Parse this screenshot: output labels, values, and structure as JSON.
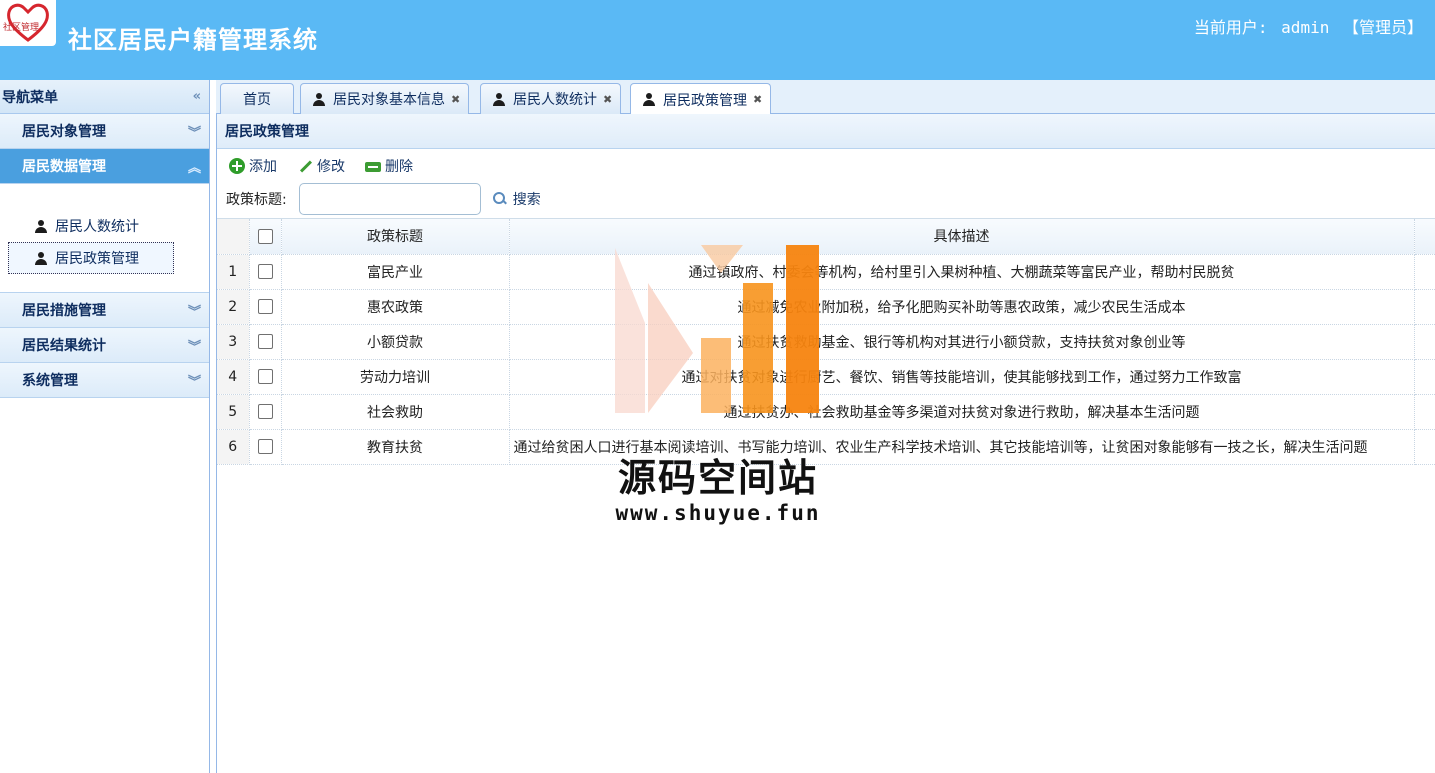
{
  "header": {
    "logo_text": "社区管理",
    "title": "社区居民户籍管理系统",
    "user_label": "当前用户:",
    "user_name": "admin",
    "user_role": "【管理员】"
  },
  "sidebar": {
    "title": "导航菜单",
    "groups": [
      {
        "label": "居民对象管理"
      },
      {
        "label": "居民数据管理"
      },
      {
        "label": "居民措施管理"
      },
      {
        "label": "居民结果统计"
      },
      {
        "label": "系统管理"
      }
    ],
    "sub_items": [
      {
        "label": "居民人数统计"
      },
      {
        "label": "居民政策管理"
      }
    ]
  },
  "tabs": [
    {
      "label": "首页"
    },
    {
      "label": "居民对象基本信息"
    },
    {
      "label": "居民人数统计"
    },
    {
      "label": "居民政策管理"
    }
  ],
  "panel": {
    "title": "居民政策管理",
    "toolbar": {
      "add": "添加",
      "edit": "修改",
      "delete": "删除"
    },
    "search": {
      "label": "政策标题:",
      "value": "",
      "button": "搜索"
    }
  },
  "table": {
    "columns": [
      "政策标题",
      "具体描述"
    ],
    "rows": [
      {
        "num": "1",
        "title": "富民产业",
        "desc": "通过镇政府、村委会等机构，给村里引入果树种植、大棚蔬菜等富民产业，帮助村民脱贫"
      },
      {
        "num": "2",
        "title": "惠农政策",
        "desc": "通过减免农业附加税，给予化肥购买补助等惠农政策，减少农民生活成本"
      },
      {
        "num": "3",
        "title": "小额贷款",
        "desc": "通过扶贫救助基金、银行等机构对其进行小额贷款，支持扶贫对象创业等"
      },
      {
        "num": "4",
        "title": "劳动力培训",
        "desc": "通过对扶贫对象进行厨艺、餐饮、销售等技能培训，使其能够找到工作，通过努力工作致富"
      },
      {
        "num": "5",
        "title": "社会救助",
        "desc": "通过扶贫办、社会救助基金等多渠道对扶贫对象进行救助，解决基本生活问题"
      },
      {
        "num": "6",
        "title": "教育扶贫",
        "desc": "通过给贫困人口进行基本阅读培训、书写能力培训、农业生产科学技术培训、其它技能培训等，让贫困对象能够有一技之长，解决生活问题"
      }
    ]
  },
  "watermark": {
    "name": "源码空间站",
    "url": "www.shuyue.fun"
  },
  "colors": {
    "header_bg": "#5ab9f5",
    "active_nav_bg": "#4a9fdf",
    "border": "#95b8e7",
    "watermark_orange": "#f7941d"
  }
}
